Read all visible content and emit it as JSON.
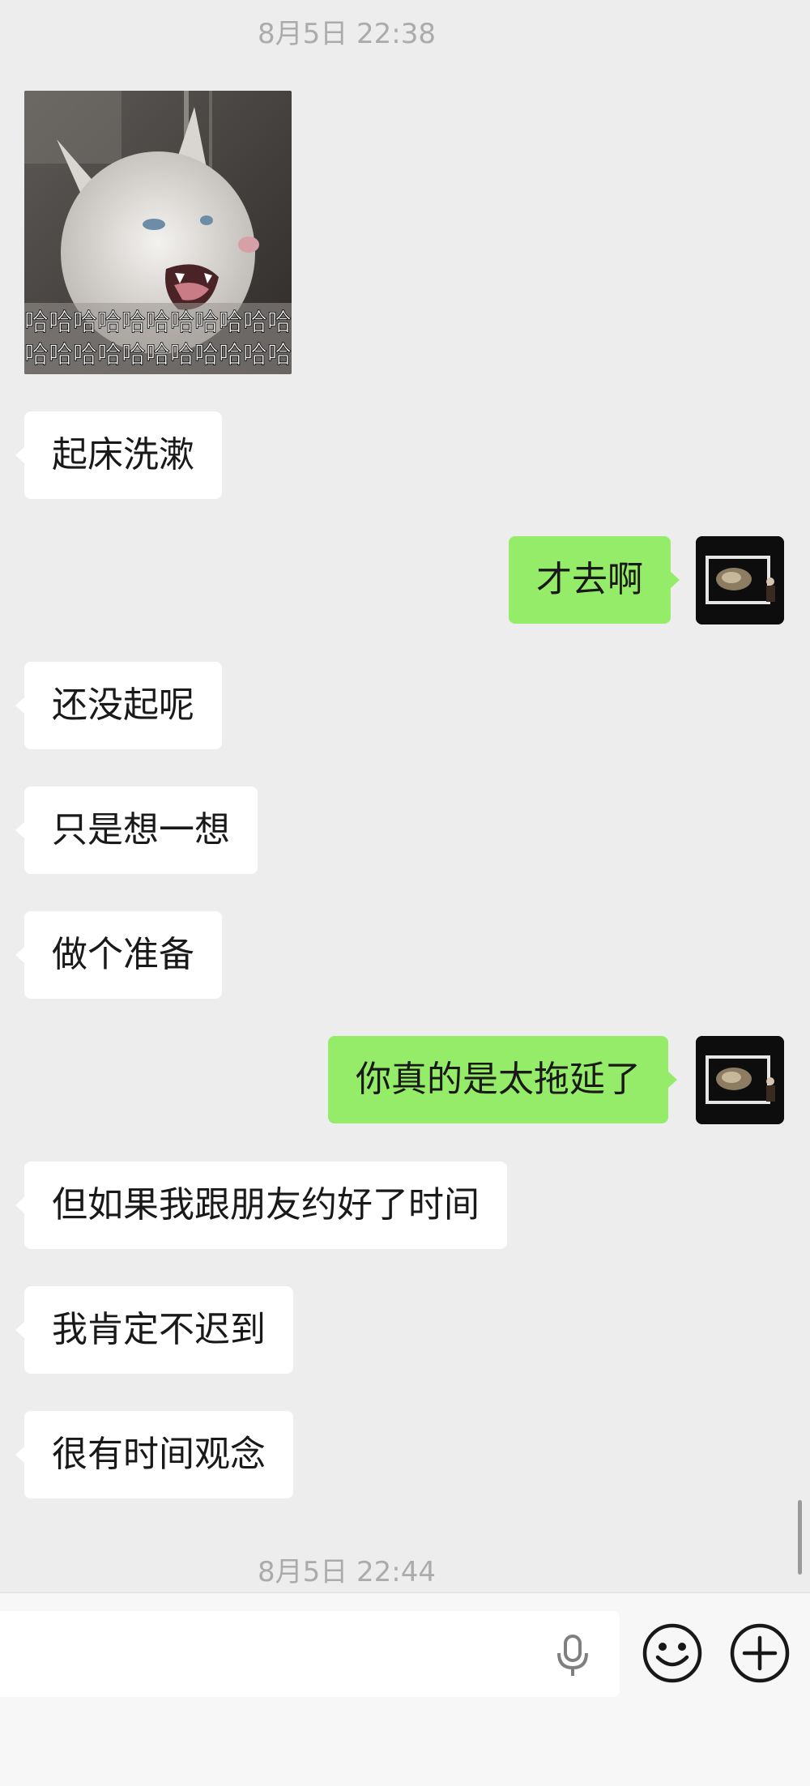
{
  "chat": {
    "timestamps": [
      "8月5日 22:38",
      "8月5日 22:44"
    ],
    "messages": [
      {
        "side": "left",
        "text": "起床洗漱"
      },
      {
        "side": "right",
        "text": "才去啊"
      },
      {
        "side": "left",
        "text": " 还没起呢"
      },
      {
        "side": "left",
        "text": "只是想一想"
      },
      {
        "side": "left",
        "text": "做个准备"
      },
      {
        "side": "right",
        "text": "你真的是太拖延了"
      },
      {
        "side": "left",
        "text": "但如果我跟朋友约好了时间"
      },
      {
        "side": "left",
        "text": "我肯定不迟到"
      },
      {
        "side": "left",
        "text": "很有时间观念"
      }
    ],
    "sticker": {
      "caption_line1": "哈哈哈哈哈哈哈哈哈哈哈",
      "caption_line2": "哈哈哈哈哈哈哈哈哈哈哈"
    }
  },
  "colors": {
    "background": "#ededed",
    "incoming_bubble": "#ffffff",
    "outgoing_bubble": "#95ec69",
    "timestamp_text": "#ababab"
  },
  "input_bar": {
    "icons": [
      "microphone-icon",
      "emoji-icon",
      "plus-icon"
    ]
  }
}
